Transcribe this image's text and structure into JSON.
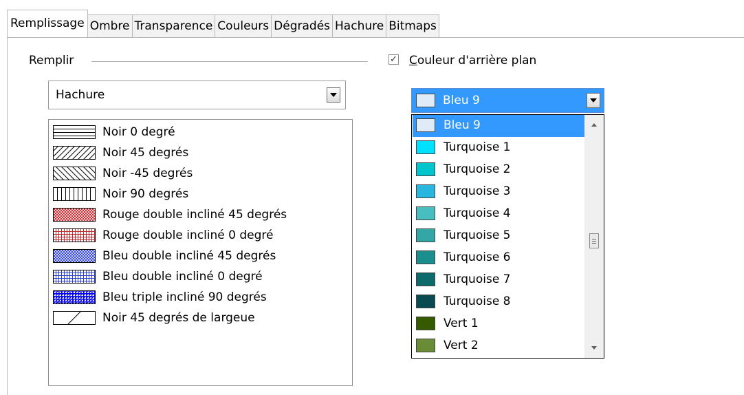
{
  "tabs": [
    {
      "label": "Remplissage",
      "active": true
    },
    {
      "label": "Ombre"
    },
    {
      "label": "Transparence"
    },
    {
      "label": "Couleurs"
    },
    {
      "label": "Dégradés"
    },
    {
      "label": "Hachure"
    },
    {
      "label": "Bitmaps"
    }
  ],
  "fill": {
    "group_label": "Remplir",
    "selected": "Hachure"
  },
  "hatches": [
    {
      "label": "Noir 0 degré",
      "icon": "hatch-horizontal",
      "color": "#000000"
    },
    {
      "label": "Noir 45 degrés",
      "icon": "hatch-diagonal-45",
      "color": "#000000"
    },
    {
      "label": "Noir -45 degrés",
      "icon": "hatch-diagonal-minus-45",
      "color": "#000000"
    },
    {
      "label": "Noir 90 degrés",
      "icon": "hatch-vertical",
      "color": "#000000"
    },
    {
      "label": "Rouge double incliné 45 degrés",
      "icon": "hatch-cross-45",
      "color": "#c0262b"
    },
    {
      "label": "Rouge double incliné 0 degré",
      "icon": "hatch-cross-0",
      "color": "#c0262b"
    },
    {
      "label": "Bleu double incliné 45 degrés",
      "icon": "hatch-cross-45",
      "color": "#2a3fd0"
    },
    {
      "label": "Bleu double incliné 0 degré",
      "icon": "hatch-cross-0",
      "color": "#2a3fd0"
    },
    {
      "label": "Bleu triple incliné 90 degrés",
      "icon": "hatch-triple",
      "color": "#0000ff"
    },
    {
      "label": "Noir 45 degrés de largeue",
      "icon": "hatch-wide-45",
      "color": "#000000"
    }
  ],
  "background": {
    "checkbox_label_underlined": "C",
    "checkbox_label_rest": "ouleur d'arrière plan",
    "checked": true,
    "selected": {
      "name": "Bleu 9",
      "color": "#dfecf8"
    },
    "options": [
      {
        "name": "Bleu 9",
        "color": "#dfecf8",
        "selected": true
      },
      {
        "name": "Turquoise 1",
        "color": "#00e1ff"
      },
      {
        "name": "Turquoise 2",
        "color": "#00c5cd"
      },
      {
        "name": "Turquoise 3",
        "color": "#29b6df"
      },
      {
        "name": "Turquoise 4",
        "color": "#48bec0"
      },
      {
        "name": "Turquoise 5",
        "color": "#33a6a6"
      },
      {
        "name": "Turquoise 6",
        "color": "#1b8e8e"
      },
      {
        "name": "Turquoise 7",
        "color": "#0e6b6b"
      },
      {
        "name": "Turquoise 8",
        "color": "#0a4a51"
      },
      {
        "name": "Vert 1",
        "color": "#355a00"
      },
      {
        "name": "Vert 2",
        "color": "#6a8c36"
      }
    ]
  }
}
